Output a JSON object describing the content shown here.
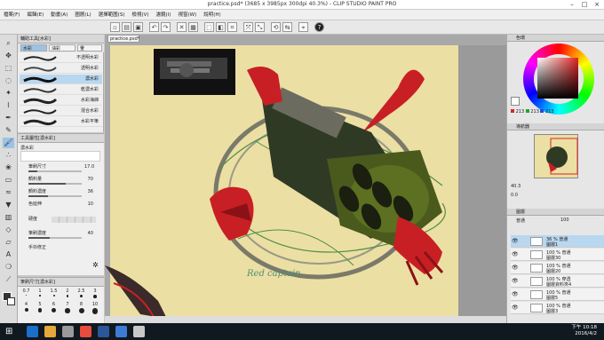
{
  "window": {
    "title": "practice.psd* (3685 x 3985px 300dpi 40.3%)  -  CLIP STUDIO PAINT PRO"
  },
  "menu": [
    "檔案(F)",
    "編輯(E)",
    "動畫(A)",
    "圖層(L)",
    "選擇範圍(S)",
    "檢視(V)",
    "濾鏡(I)",
    "視窗(W)",
    "說明(H)"
  ],
  "subtool": {
    "group_tab": "輔助工具[水彩]",
    "tabs": [
      "水彩",
      "油彩",
      "暈"
    ],
    "brushes": [
      "不透明水彩",
      "透明水彩",
      "濃水彩",
      "乾濃水彩",
      "水彩海綿",
      "混合水彩",
      "水彩平筆"
    ]
  },
  "tool_property": {
    "header": "工具屬性[濃水彩]",
    "preset": "濃水彩",
    "rows": [
      {
        "label": "筆刷尺寸",
        "value": "17.0",
        "fill": 0.17
      },
      {
        "label": "顏料量",
        "value": "70",
        "fill": 0.7
      },
      {
        "label": "顏料濃度",
        "value": "36",
        "fill": 0.36
      },
      {
        "label": "色延伸",
        "value": "10",
        "fill": 0.1
      },
      {
        "label": "硬度",
        "value": "",
        "fill": 0.0
      },
      {
        "label": "筆刷濃度",
        "value": "40",
        "fill": 0.4
      },
      {
        "label": "手抖修正",
        "value": "",
        "fill": 0.0
      }
    ]
  },
  "brush_size": {
    "header": "筆刷尺寸[濃水彩]",
    "sizes": [
      "0.7",
      "1",
      "1.5",
      "2",
      "2.5",
      "3",
      "4",
      "5",
      "6",
      "7",
      "8",
      "10"
    ]
  },
  "document": {
    "tab": "practice.psd*",
    "canvas_text": "Red captain"
  },
  "color": {
    "header": "色環",
    "r": "213",
    "g": "213",
    "b": "213",
    "accent": "#d9262a"
  },
  "navigator": {
    "header": "導航器",
    "zoom": "40.3",
    "rotate": "0.0"
  },
  "layers": {
    "header": "圖層",
    "blend": "普通",
    "opacity": "100",
    "items": [
      {
        "name": "圖層1",
        "mode": "36 % 普通",
        "selected": true
      },
      {
        "name": "圖層30",
        "mode": "100 % 普通",
        "selected": false
      },
      {
        "name": "圖層20",
        "mode": "100 % 普通",
        "selected": false
      },
      {
        "name": "圖層資料夾4",
        "mode": "100 % 穿透",
        "selected": false
      },
      {
        "name": "圖層5",
        "mode": "100 % 普通",
        "selected": false
      },
      {
        "name": "圖層3",
        "mode": "100 % 普通",
        "selected": false
      }
    ]
  },
  "taskbar": {
    "time": "下午 10:18",
    "date": "2016/4/2"
  }
}
